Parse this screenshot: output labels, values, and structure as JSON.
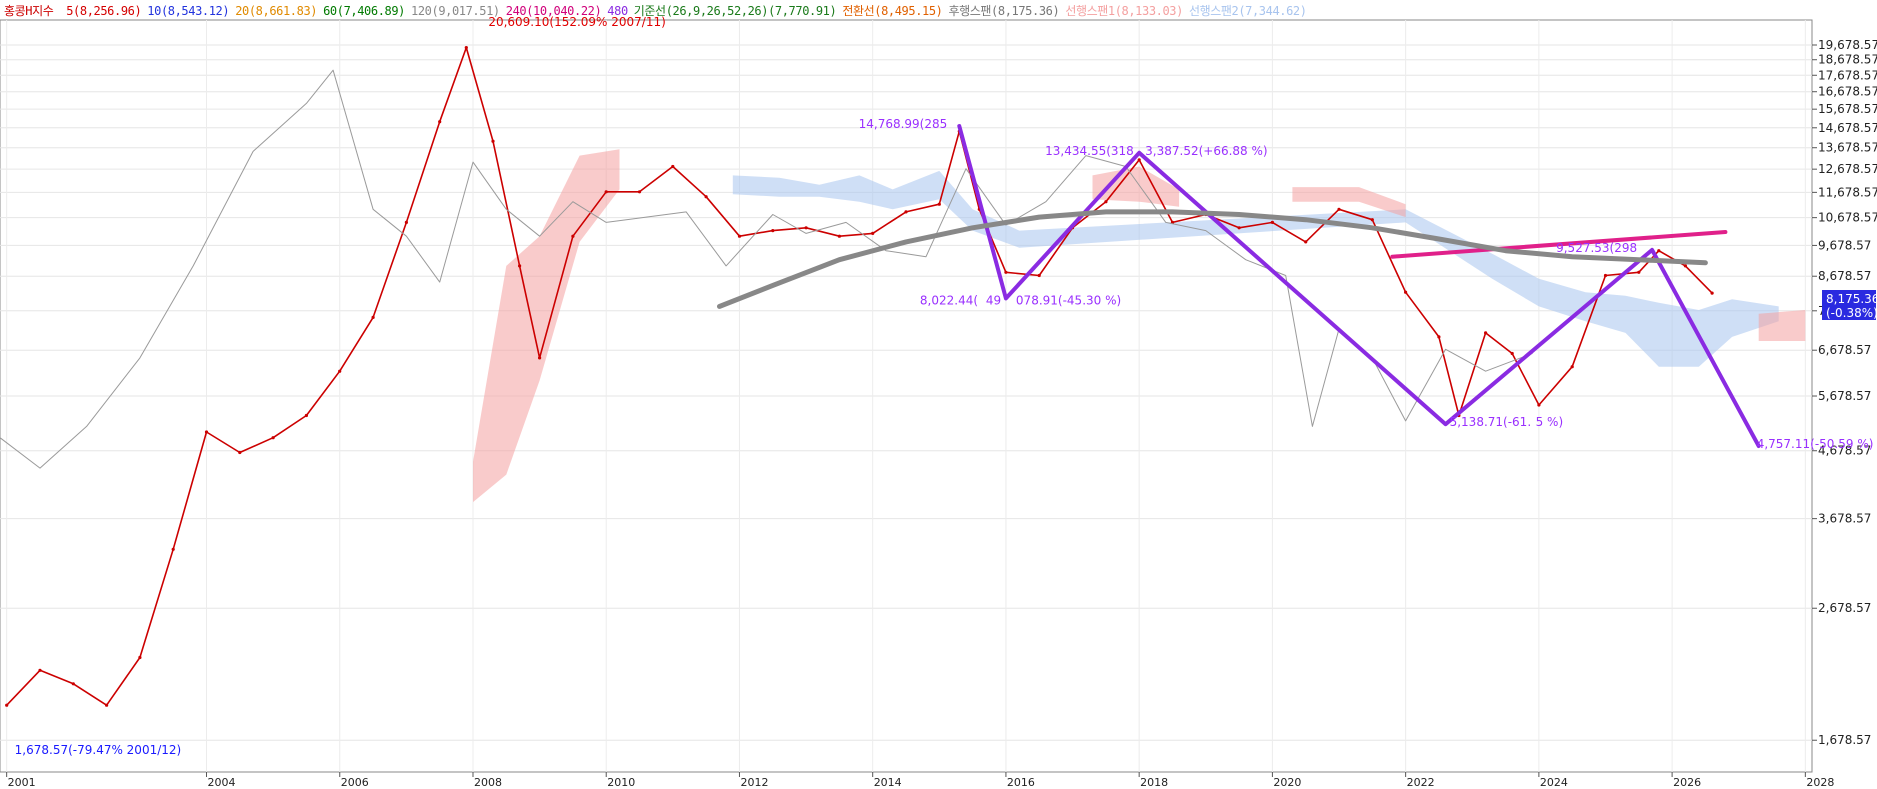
{
  "legend": {
    "index": {
      "text": "홍콩H지수",
      "color": "#cc0000"
    },
    "items": [
      {
        "text": "5(8,256.96)",
        "color": "#d40000"
      },
      {
        "text": "10(8,543.12)",
        "color": "#2233dd"
      },
      {
        "text": "20(8,661.83)",
        "color": "#e08a00"
      },
      {
        "text": "60(7,406.89)",
        "color": "#007a00"
      },
      {
        "text": "120(9,017.51)",
        "color": "#888888"
      },
      {
        "text": "240(10,040.22)",
        "color": "#d0007a"
      },
      {
        "text": "480",
        "color": "#8a2be2"
      },
      {
        "text": "기준선(26,9,26,52,26)(7,770.91)",
        "color": "#1a7a1a"
      },
      {
        "text": "전환선(8,495.15)",
        "color": "#e06000"
      },
      {
        "text": "후행스팬(8,175.36)",
        "color": "#777777"
      },
      {
        "text": "선행스팬1(8,133.03)",
        "color": "#f4a0a0"
      },
      {
        "text": "선행스팬2(7,344.62)",
        "color": "#a8c4ee"
      }
    ]
  },
  "price_box": {
    "value": "8,175.36",
    "change": "(-0.38%)",
    "bg": "#2a2ae0"
  },
  "annotations": {
    "high": "20,609.10(152.09% 2007/11)",
    "low": "1,678.57(-79.47% 2001/12)",
    "p2015": "14,768.99(285 ",
    "p2016": "8,022.44(",
    "p2016b": "49 ",
    "p2016c": "078.91(-45.30 %)",
    "p2018": "13,434.55(318 ",
    "p2018b": "3,387.52(+66.88 %)",
    "p2022": "5,138.71(-61.",
    "p2022b": "5 %)",
    "p2025": "9,527.53(298 ",
    "p2027": "4,757.11(-50.59 %)"
  },
  "chart_data": {
    "type": "line",
    "title": "홍콩H지수",
    "y_scale": "log",
    "y_ticks": [
      "19,678.57",
      "18,678.57",
      "17,678.57",
      "16,678.57",
      "15,678.57",
      "14,678.57",
      "13,678.57",
      "12,678.57",
      "11,678.57",
      "10,678.57",
      "9,678.57",
      "8,678.57",
      "7,678.57",
      "6,678.57",
      "5,678.57",
      "4,678.57",
      "3,678.57",
      "2,678.57",
      "1,678.57"
    ],
    "y_tick_values": [
      19678.57,
      18678.57,
      17678.57,
      16678.57,
      15678.57,
      14678.57,
      13678.57,
      12678.57,
      11678.57,
      10678.57,
      9678.57,
      8678.57,
      7678.57,
      6678.57,
      5678.57,
      4678.57,
      3678.57,
      2678.57,
      1678.57
    ],
    "x_ticks": [
      "2001",
      "2004",
      "2006",
      "2008",
      "2010",
      "2012",
      "2014",
      "2016",
      "2018",
      "2020",
      "2022",
      "2024",
      "2026",
      "2028",
      "2028"
    ],
    "x_tick_years": [
      2001.0,
      2004.0,
      2006.0,
      2008.0,
      2010.0,
      2012.0,
      2014.0,
      2016.0,
      2018.0,
      2020.0,
      2022.0,
      2024.0,
      2026.0,
      2028.0
    ],
    "series": [
      {
        "name": "홍콩H지수",
        "color": "#cc0000",
        "x": [
          2001.0,
          2001.5,
          2002.0,
          2002.5,
          2003.0,
          2003.5,
          2004.0,
          2004.5,
          2005.0,
          2005.5,
          2006.0,
          2006.5,
          2007.0,
          2007.5,
          2007.9,
          2008.3,
          2008.7,
          2009.0,
          2009.5,
          2010.0,
          2010.5,
          2011.0,
          2011.5,
          2012.0,
          2012.5,
          2013.0,
          2013.5,
          2014.0,
          2014.5,
          2015.0,
          2015.3,
          2015.6,
          2016.0,
          2016.5,
          2017.0,
          2017.5,
          2018.0,
          2018.5,
          2019.0,
          2019.5,
          2020.0,
          2020.5,
          2021.0,
          2021.5,
          2022.0,
          2022.5,
          2022.8,
          2023.2,
          2023.6,
          2024.0,
          2024.5,
          2025.0,
          2025.5,
          2025.8,
          2026.2,
          2026.6
        ],
        "y": [
          1900,
          2150,
          2050,
          1900,
          2250,
          3300,
          5000,
          4650,
          4900,
          5300,
          6200,
          7500,
          10500,
          15000,
          19500,
          14000,
          9000,
          6500,
          10000,
          11700,
          11700,
          12800,
          11500,
          10000,
          10200,
          10300,
          10000,
          10100,
          10900,
          11200,
          14500,
          11000,
          8800,
          8700,
          10300,
          11300,
          13100,
          10500,
          10800,
          10300,
          10500,
          9800,
          11000,
          10600,
          8200,
          7000,
          5300,
          7100,
          6600,
          5500,
          6300,
          8700,
          8800,
          9500,
          9000,
          8175
        ]
      },
      {
        "name": "후행스팬",
        "color": "#9a9a9a",
        "x": [
          2000.9,
          2001.5,
          2002.2,
          2003.0,
          2003.8,
          2004.7,
          2005.5,
          2005.9,
          2006.5,
          2007.0,
          2007.5,
          2008.0,
          2008.5,
          2009.0,
          2009.5,
          2010.0,
          2010.6,
          2011.2,
          2011.8,
          2012.5,
          2013.0,
          2013.6,
          2014.2,
          2014.8,
          2015.4,
          2016.0,
          2016.6,
          2017.2,
          2017.8,
          2018.4,
          2019.0,
          2019.6,
          2020.2,
          2020.6,
          2021.0,
          2021.5,
          2022.0,
          2022.6,
          2023.2,
          2023.9
        ],
        "y": [
          4900,
          4400,
          5100,
          6500,
          9000,
          13500,
          16000,
          18000,
          11000,
          10000,
          8500,
          13000,
          11000,
          10000,
          11300,
          10500,
          10700,
          10900,
          9000,
          10800,
          10100,
          10500,
          9500,
          9300,
          12700,
          10400,
          11300,
          13300,
          12800,
          10500,
          10200,
          9200,
          8700,
          5100,
          7200,
          6500,
          5200,
          6700,
          6200,
          6600
        ]
      },
      {
        "name": "480",
        "color": "#8a2be2",
        "x": [
          2015.3,
          2016.0,
          2018.0,
          2022.6,
          2025.7,
          2027.3
        ],
        "y": [
          14768.99,
          8022.44,
          13434.55,
          5138.71,
          9527.53,
          4757.11
        ]
      },
      {
        "name": "240",
        "color": "#e0208a",
        "x": [
          2021.8,
          2026.8
        ],
        "y": [
          9300,
          10150
        ]
      },
      {
        "name": "120",
        "color": "#888888",
        "x": [
          2011.7,
          2012.5,
          2013.5,
          2014.5,
          2015.5,
          2016.5,
          2017.5,
          2018.5,
          2019.5,
          2020.5,
          2021.5,
          2022.5,
          2023.5,
          2024.5,
          2025.5,
          2026.5
        ],
        "y": [
          7800,
          8400,
          9200,
          9800,
          10300,
          10700,
          10900,
          10900,
          10800,
          10600,
          10300,
          9900,
          9500,
          9300,
          9200,
          9100
        ]
      }
    ]
  }
}
